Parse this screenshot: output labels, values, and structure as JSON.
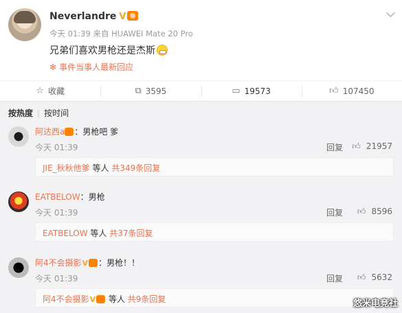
{
  "post": {
    "author": "Neverlandre",
    "meta": "今天 01:39 来自 HUAWEI Mate 20 Pro",
    "content": "兄弟们喜欢男枪还是杰斯",
    "hot_event": "事件当事人最新回应"
  },
  "actions": [
    {
      "label": "收藏",
      "icon": "star-icon"
    },
    {
      "label": "3595",
      "icon": "share-icon"
    },
    {
      "label": "19573",
      "icon": "comment-icon"
    },
    {
      "label": "107450",
      "icon": "like-icon"
    }
  ],
  "sort": {
    "hot": "按热度",
    "time": "按时间"
  },
  "comments": [
    {
      "user": "阿达西a",
      "text": "：男枪吧 爹",
      "time": "今天 01:39",
      "reply": "回复",
      "likes": "21957",
      "sub_user": "JIE_秋秋他爹",
      "sub_mid": " 等人 ",
      "sub_count": "共349条回复"
    },
    {
      "user": "EATBELOW",
      "text": "：男枪",
      "time": "今天 01:39",
      "reply": "回复",
      "likes": "8596",
      "sub_user": "EATBELOW",
      "sub_mid": " 等人 ",
      "sub_count": "共37条回复"
    },
    {
      "user": "阿4不会摄影",
      "text": "：男枪！！",
      "time": "今天 01:39",
      "reply": "回复",
      "likes": "5632",
      "sub_user": "阿4不会摄影",
      "sub_mid": " 等人 ",
      "sub_count": "共9条回复"
    }
  ],
  "watermark": "悠米电竞社",
  "colors": {
    "accent": "#eb7350",
    "badge": "#ff8200",
    "bg_comments": "#f2f2f5"
  }
}
